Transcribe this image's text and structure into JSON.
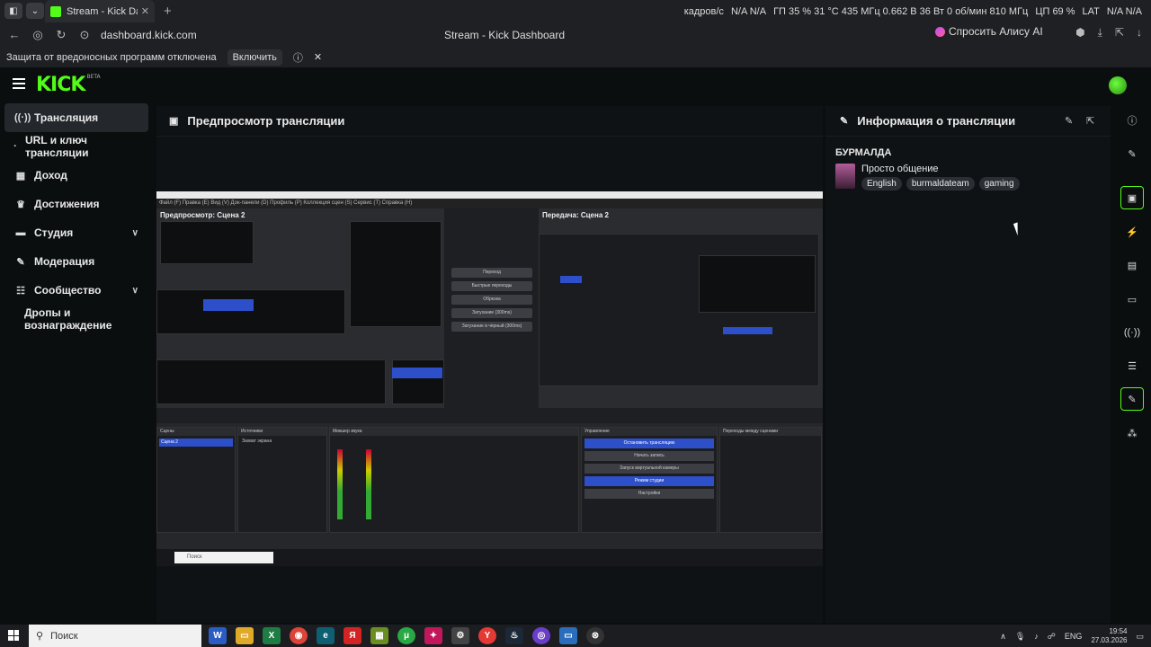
{
  "browser": {
    "tab_title": "Stream - Kick Dashb",
    "url": "dashboard.kick.com",
    "page_title": "Stream - Kick Dashboard",
    "alice_label": "Спросить Алису AI",
    "status_fps_label": "кадров/с",
    "status_fps_value": "N/A N/A",
    "status_gpu": "ГП 35 % 31 °C 435 МГц 0.662 В 36 Вт 0 об/мин 810 МГц",
    "status_cpu": "ЦП 69 %",
    "status_lang": "LAT",
    "status_na": "N/A N/A",
    "protection_text": "Защита от вредоносных программ отключена",
    "enable_label": "Включить"
  },
  "kick": {
    "logo": "KICK",
    "logo_badge": "BETA"
  },
  "sidebar": {
    "items": [
      {
        "label": "Трансляция",
        "icon": "broadcast-icon"
      },
      {
        "label": "URL и ключ трансляции",
        "icon": "dot-icon"
      },
      {
        "label": "Доход",
        "icon": "chart-icon"
      },
      {
        "label": "Достижения",
        "icon": "trophy-icon"
      },
      {
        "label": "Студия",
        "icon": "studio-icon"
      },
      {
        "label": "Модерация",
        "icon": "wrench-icon"
      },
      {
        "label": "Сообщество",
        "icon": "community-icon"
      },
      {
        "label": "Дропы и вознаграждение",
        "icon": ""
      }
    ]
  },
  "preview": {
    "title": "Предпросмотр трансляции",
    "obs_left_label": "Предпросмотр: Сцена 2",
    "obs_right_label": "Передача: Сцена 2",
    "obs_menu": "Файл (F)   Правка (E)   Вид (V)   Док-панели (D)   Профиль (P)   Коллекция сцен (S)   Сервис (T)   Справка (H)",
    "obs_controls": [
      "Переход",
      "Быстрые переходы",
      "Обрезка",
      "Затухание (300ms)",
      "Затухание в чёрный (300ms)"
    ],
    "obs_docks": [
      "Сцены",
      "Источники",
      "Микшер звука",
      "Управление",
      "Переходы между сценами"
    ],
    "obs_scene": "Сцена 2",
    "obs_source": "Захват экрана",
    "obs_buttons": [
      "Остановить трансляцию",
      "Начать запись",
      "Запуск виртуальной камеры",
      "Режим студии",
      "Настройки"
    ],
    "mini_search": "Поиск"
  },
  "info": {
    "title": "Информация о трансляции",
    "stream_title": "БУРМАЛДА",
    "category": "Просто общение",
    "tags": [
      "English",
      "burmaldateam",
      "gaming"
    ]
  },
  "taskbar": {
    "search": "Поиск",
    "lang": "ENG",
    "time": "19:54",
    "date": "27.03.2026"
  },
  "colors": {
    "accent": "#53fc18",
    "obs_blue": "#2d4fc9"
  }
}
